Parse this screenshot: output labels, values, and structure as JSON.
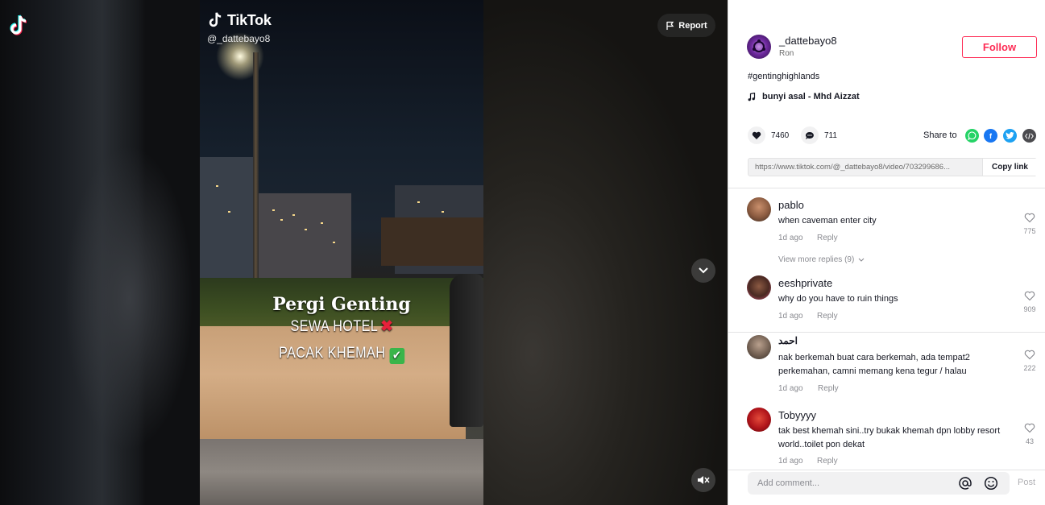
{
  "video": {
    "brand": "TikTok",
    "handle": "@_dattebayo8",
    "report_label": "Report",
    "overlay": {
      "line1": "Pergi Genting",
      "line2": "SEWA HOTEL",
      "line2_emoji": "✖",
      "line3": "PACAK KHEMAH",
      "line3_emoji": "✔"
    }
  },
  "author": {
    "username": "_dattebayo8",
    "nickname": "Ron",
    "follow_label": "Follow"
  },
  "post": {
    "hashtag": "#gentinghighlands",
    "music": "bunyi asal - Mhd Aizzat",
    "likes": "7460",
    "comments": "711",
    "share_label": "Share to",
    "link": "https://www.tiktok.com/@_dattebayo8/video/703299686...",
    "copy_label": "Copy link"
  },
  "comments": [
    {
      "user": "pablo",
      "text": "when caveman enter city",
      "time": "1d ago",
      "reply": "Reply",
      "likes": "775"
    },
    {
      "user": "eeshprivate",
      "text": "why do you have to ruin things",
      "time": "1d ago",
      "reply": "Reply",
      "likes": "909"
    },
    {
      "user": "احمد",
      "text": "nak berkemah buat cara berkemah, ada tempat2 perkemahan, camni memang kena tegur / halau",
      "time": "1d ago",
      "reply": "Reply",
      "likes": "222"
    },
    {
      "user": "Tobyyyy",
      "text": "tak best khemah sini..try bukak khemah dpn lobby resort world..toilet pon dekat",
      "time": "1d ago",
      "reply": "Reply",
      "likes": "43"
    }
  ],
  "view_more": "View more replies (9)",
  "composer": {
    "placeholder": "Add comment...",
    "post_label": "Post"
  }
}
